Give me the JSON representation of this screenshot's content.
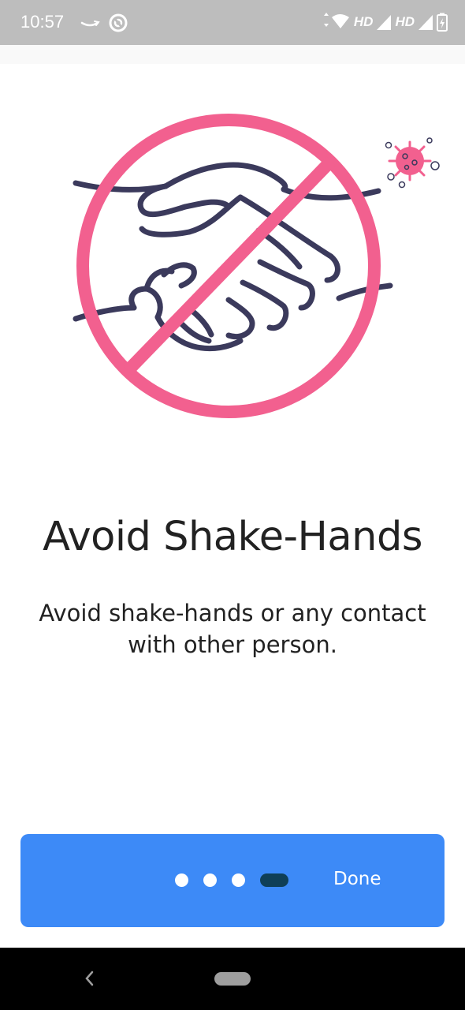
{
  "status_bar": {
    "time": "10:57",
    "network_label_1": "HD",
    "network_label_2": "HD",
    "icons": [
      "amazon-icon",
      "at-icon",
      "wifi-icon",
      "signal-icon",
      "signal-icon",
      "battery-icon"
    ]
  },
  "onboarding": {
    "illustration": "no-handshake-illustration",
    "title": "Avoid Shake-Hands",
    "description": "Avoid shake-hands or any contact with other person."
  },
  "pager": {
    "total_pages": 4,
    "current_page": 4,
    "done_label": "Done"
  },
  "colors": {
    "accent": "#3d8af7",
    "active_dot": "#0f3f57",
    "prohibition": "#f2608f",
    "line_art": "#3b3a5c"
  },
  "nav_bar": {
    "icons": [
      "back-icon",
      "home-pill-icon"
    ]
  }
}
